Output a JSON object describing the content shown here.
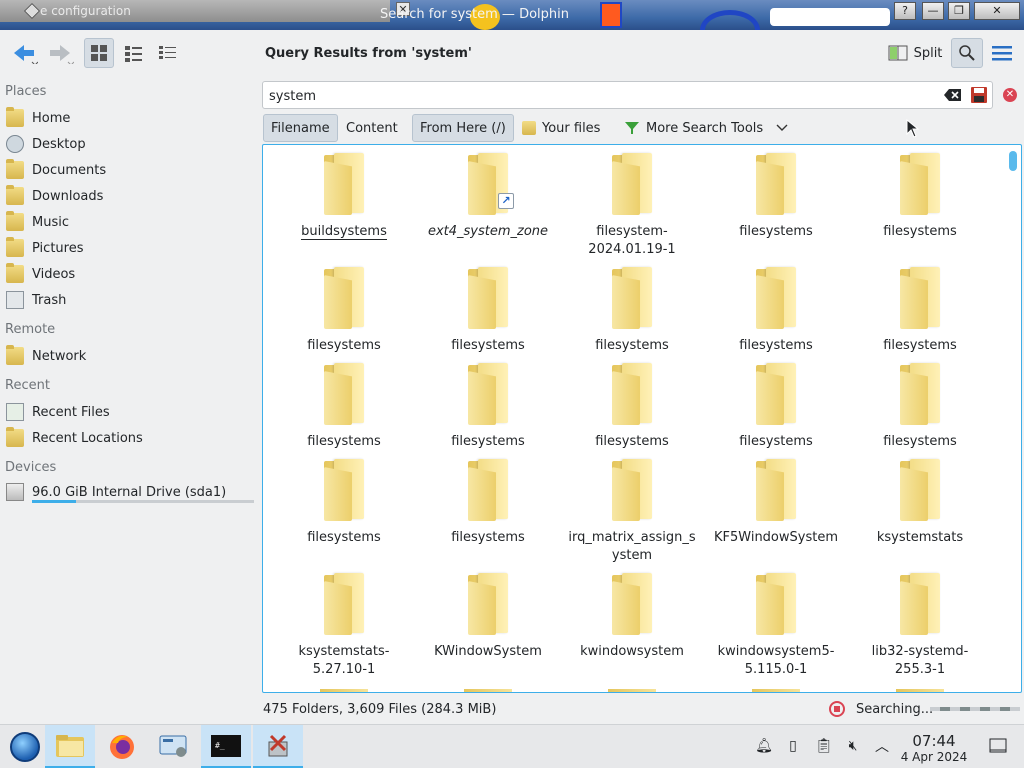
{
  "window": {
    "title": "Search for system — Dolphin",
    "background_window_text": "e configuration"
  },
  "toolbar": {
    "query_title": "Query Results from 'system'",
    "split_label": "Split"
  },
  "sidebar": {
    "sections": {
      "places": "Places",
      "remote": "Remote",
      "recent": "Recent",
      "devices": "Devices"
    },
    "places": [
      {
        "label": "Home",
        "icon": "home-folder-icon"
      },
      {
        "label": "Desktop",
        "icon": "desktop-icon"
      },
      {
        "label": "Documents",
        "icon": "documents-folder-icon"
      },
      {
        "label": "Downloads",
        "icon": "downloads-folder-icon"
      },
      {
        "label": "Music",
        "icon": "music-folder-icon"
      },
      {
        "label": "Pictures",
        "icon": "pictures-folder-icon"
      },
      {
        "label": "Videos",
        "icon": "videos-folder-icon"
      },
      {
        "label": "Trash",
        "icon": "trash-icon"
      }
    ],
    "remote": [
      {
        "label": "Network",
        "icon": "network-icon"
      }
    ],
    "recent": [
      {
        "label": "Recent Files",
        "icon": "recent-files-icon"
      },
      {
        "label": "Recent Locations",
        "icon": "recent-locations-icon"
      }
    ],
    "devices": [
      {
        "label": "96.0 GiB Internal Drive (sda1)",
        "icon": "drive-icon",
        "usage_fraction": 0.2
      }
    ]
  },
  "search": {
    "value": "system"
  },
  "filters": {
    "filename": "Filename",
    "content": "Content",
    "from_here": "From Here (/)",
    "your_files": "Your files",
    "more_tools": "More Search Tools"
  },
  "files": [
    {
      "name": "buildsystems",
      "style": "underline"
    },
    {
      "name": "ext4_system_zone",
      "style": "italic",
      "symlink": true
    },
    {
      "name": "filesystem-2024.01.19-1"
    },
    {
      "name": "filesystems"
    },
    {
      "name": "filesystems"
    },
    {
      "name": "filesystems"
    },
    {
      "name": "filesystems"
    },
    {
      "name": "filesystems"
    },
    {
      "name": "filesystems"
    },
    {
      "name": "filesystems"
    },
    {
      "name": "filesystems"
    },
    {
      "name": "filesystems"
    },
    {
      "name": "filesystems"
    },
    {
      "name": "filesystems"
    },
    {
      "name": "filesystems"
    },
    {
      "name": "filesystems"
    },
    {
      "name": "filesystems"
    },
    {
      "name": "irq_matrix_assign_system"
    },
    {
      "name": "KF5WindowSystem"
    },
    {
      "name": "ksystemstats"
    },
    {
      "name": "ksystemstats-5.27.10-1"
    },
    {
      "name": "KWindowSystem"
    },
    {
      "name": "kwindowsystem"
    },
    {
      "name": "kwindowsystem5-5.115.0-1"
    },
    {
      "name": "lib32-systemd-255.3-1"
    }
  ],
  "status": {
    "summary": "475 Folders, 3,609 Files (284.3 MiB)",
    "searching": "Searching..."
  },
  "taskbar": {
    "time": "07:44",
    "date": "4 Apr 2024"
  },
  "colors": {
    "accent": "#3daee9",
    "danger": "#da4453"
  }
}
